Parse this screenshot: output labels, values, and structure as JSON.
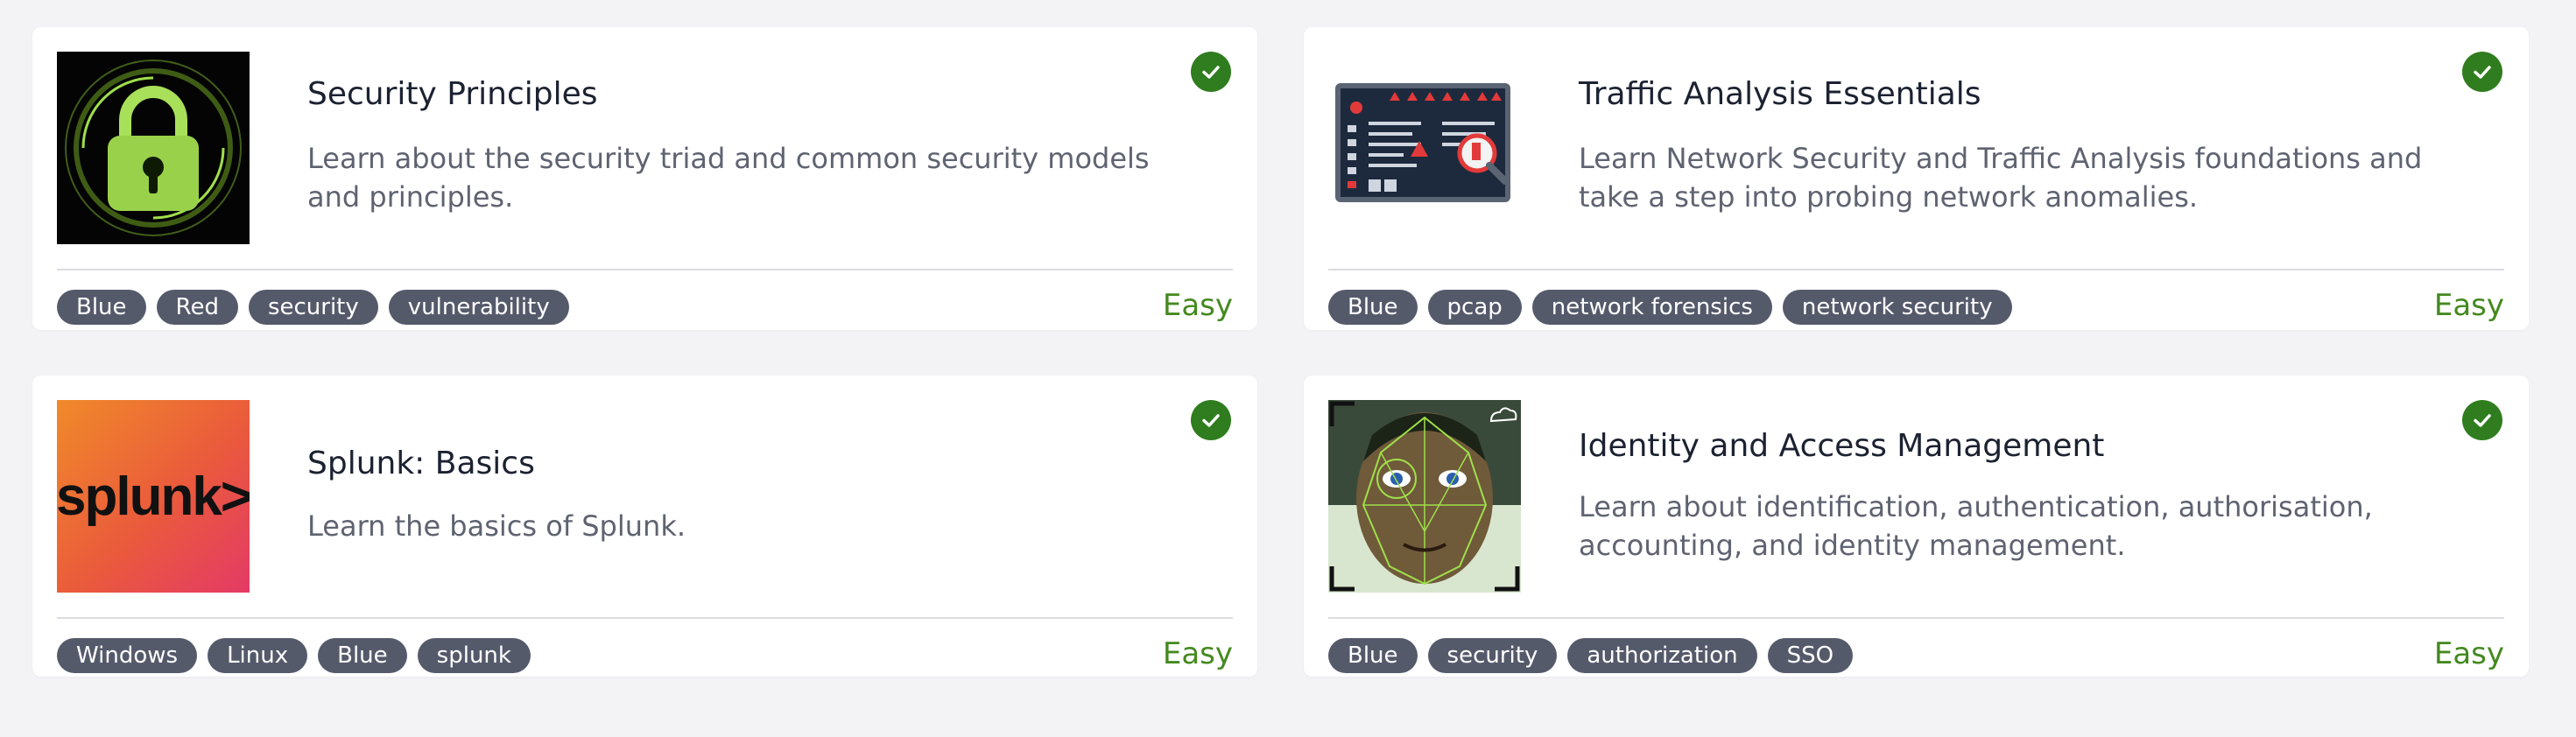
{
  "cards": [
    {
      "title": "Security Principles",
      "description": "Learn about the security triad and common security models and principles.",
      "tags": [
        "Blue",
        "Red",
        "security",
        "vulnerability"
      ],
      "difficulty": "Easy",
      "completed": true,
      "image": "padlock-image"
    },
    {
      "title": "Traffic Analysis Essentials",
      "description": "Learn Network Security and Traffic Analysis foundations and take a step into probing network anomalies.",
      "tags": [
        "Blue",
        "pcap",
        "network forensics",
        "network security"
      ],
      "difficulty": "Easy",
      "completed": true,
      "image": "threat-dashboard-image"
    },
    {
      "title": "Splunk: Basics",
      "description": "Learn the basics of Splunk.",
      "tags": [
        "Windows",
        "Linux",
        "Blue",
        "splunk"
      ],
      "difficulty": "Easy",
      "completed": true,
      "image": "splunk-logo-image",
      "logo_text": "splunk>"
    },
    {
      "title": "Identity and Access Management",
      "description": "Learn about identification, authentication, authorisation, accounting, and identity management.",
      "tags": [
        "Blue",
        "security",
        "authorization",
        "SSO"
      ],
      "difficulty": "Easy",
      "completed": true,
      "image": "face-recognition-image"
    }
  ],
  "colors": {
    "accent_green": "#2f7d1e",
    "difficulty_green": "#44891f",
    "tag_bg": "#555a6b"
  }
}
